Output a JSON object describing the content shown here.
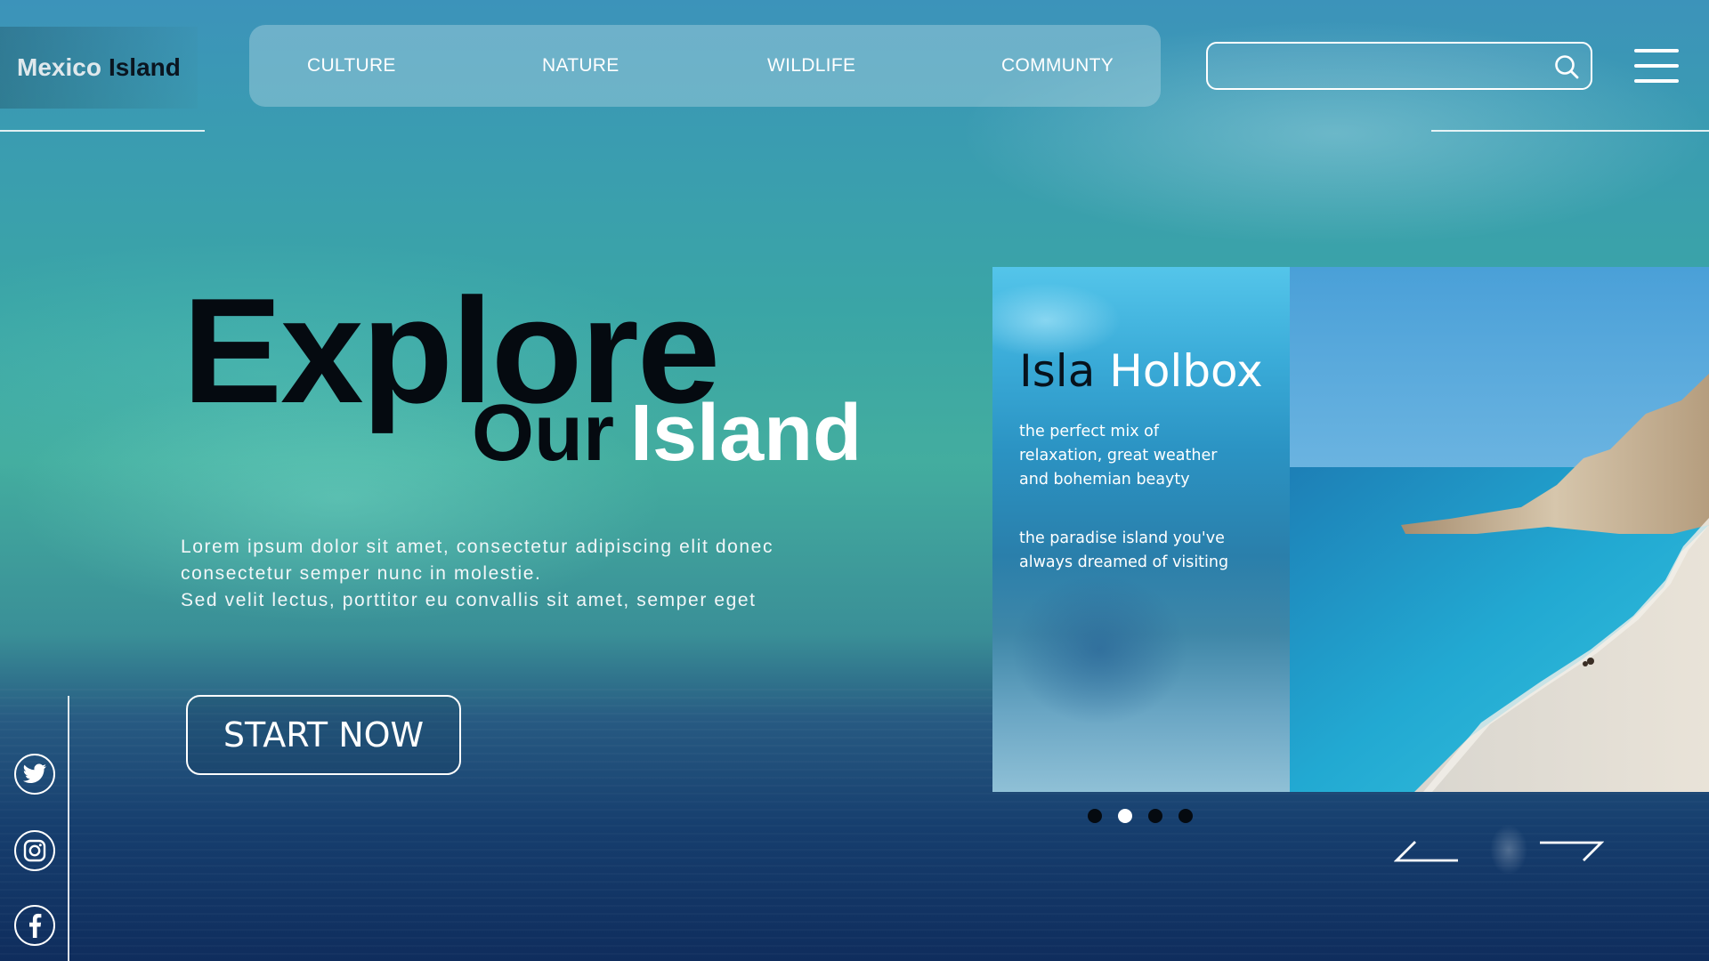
{
  "brand": {
    "part1": "Mexico",
    "part2": "Island"
  },
  "nav": {
    "items": [
      "CULTURE",
      "NATURE",
      "WILDLIFE",
      "COMMUNTY"
    ]
  },
  "search": {
    "placeholder": "",
    "icon": "search-icon"
  },
  "menu": {
    "icon": "hamburger-menu-icon"
  },
  "hero": {
    "title_line1": "Explore",
    "title_our": "Our",
    "title_island": "Island",
    "description": [
      "Lorem ipsum dolor sit amet, consectetur adipiscing elit donec",
      "consectetur semper nunc in molestie.",
      "Sed velit lectus, porttitor eu convallis sit amet, semper eget"
    ],
    "cta_label": "START NOW"
  },
  "social": [
    "twitter-icon",
    "instagram-icon",
    "facebook-icon"
  ],
  "card": {
    "title_part1": "Isla",
    "title_part2": "Holbox",
    "text1": [
      "the perfect mix of",
      "relaxation, great weather",
      "and bohemian beayty"
    ],
    "text2": [
      "the paradise island you've",
      "always dreamed of visiting"
    ]
  },
  "carousel": {
    "slide_count": 4,
    "active_index": 1
  },
  "colors": {
    "accent_white": "#ffffff",
    "text_dark": "#050a10",
    "dot_inactive": "#050a10"
  }
}
